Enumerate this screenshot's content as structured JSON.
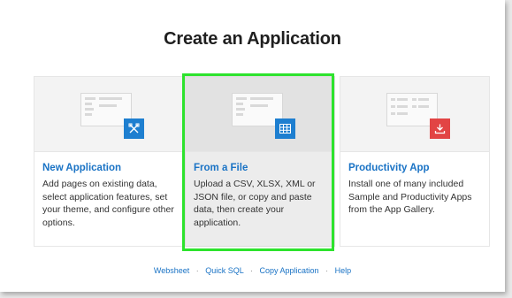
{
  "title": "Create an Application",
  "cards": [
    {
      "title": "New Application",
      "description": "Add pages on existing data, select application features, set your theme, and configure other options.",
      "icon": "tools-icon"
    },
    {
      "title": "From a File",
      "description": "Upload a CSV, XLSX, XML or JSON file, or copy and paste data, then create your application.",
      "icon": "table-icon",
      "selected": true
    },
    {
      "title": "Productivity App",
      "description": "Install one of many included Sample and Productivity Apps from the App Gallery.",
      "icon": "download-icon"
    }
  ],
  "links": [
    "Websheet",
    "Quick SQL",
    "Copy Application",
    "Help"
  ],
  "link_separator": "·",
  "colors": {
    "accent": "#1a73c5",
    "badge_blue": "#1e7fd0",
    "badge_red": "#e24444",
    "highlight": "#2de32d"
  }
}
